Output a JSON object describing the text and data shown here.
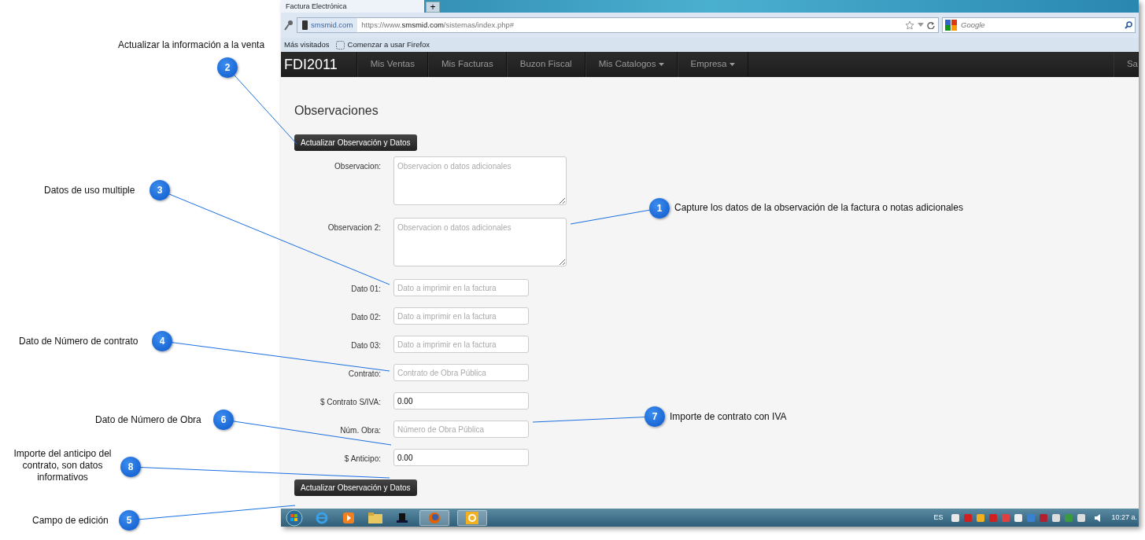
{
  "browser": {
    "tab_title": "Factura Electrónica",
    "new_tab": "+",
    "identity": "smsmid.com",
    "url": "https://www.**smsmid.com**/sistemas/index.php#",
    "search_placeholder": "Google",
    "bookmarks": [
      "Más visitados",
      "Comenzar a usar Firefox"
    ]
  },
  "navbar": {
    "brand": "FDI2011",
    "items": [
      {
        "label": "Mis Ventas",
        "dropdown": false
      },
      {
        "label": "Mis Facturas",
        "dropdown": false
      },
      {
        "label": "Buzon Fiscal",
        "dropdown": false
      },
      {
        "label": "Mis Catalogos",
        "dropdown": true
      },
      {
        "label": "Empresa",
        "dropdown": true
      }
    ],
    "right_item": "Sa"
  },
  "page": {
    "heading": "Observaciones",
    "button_top": "Actualizar Observación y Datos",
    "button_bottom": "Actualizar Observación y Datos",
    "fields": [
      {
        "kind": "textarea",
        "label": "Observacion:",
        "placeholder": "Observacion o datos adicionales"
      },
      {
        "kind": "textarea",
        "label": "Observacion 2:",
        "placeholder": "Observacion o datos adicionales"
      },
      {
        "kind": "input",
        "label": "Dato 01:",
        "placeholder": "Dato a imprimir en la factura"
      },
      {
        "kind": "input",
        "label": "Dato 02:",
        "placeholder": "Dato a imprimir en la factura"
      },
      {
        "kind": "input",
        "label": "Dato 03:",
        "placeholder": "Dato a imprimir en la factura"
      },
      {
        "kind": "input",
        "label": "Contrato:",
        "placeholder": "Contrato de Obra Pública"
      },
      {
        "kind": "input",
        "label": "$ Contrato S/IVA:",
        "value": "0.00"
      },
      {
        "kind": "input",
        "label": "Núm. Obra:",
        "placeholder": "Número de Obra Pública"
      },
      {
        "kind": "input",
        "label": "$ Anticipo:",
        "value": "0.00"
      }
    ]
  },
  "taskbar": {
    "language": "ES",
    "clock": "10:27 a."
  },
  "callouts": [
    {
      "number": "1",
      "text": "Capture los datos de la observación de la factura o notas adicionales"
    },
    {
      "number": "2",
      "text": "Actualizar la información a la venta"
    },
    {
      "number": "3",
      "text": "Datos de uso multiple"
    },
    {
      "number": "4",
      "text": "Dato de Número de contrato"
    },
    {
      "number": "5",
      "text": "Campo de edición"
    },
    {
      "number": "6",
      "text": "Dato de Número de Obra"
    },
    {
      "number": "7",
      "text": "Importe de contrato con IVA"
    },
    {
      "number": "8",
      "text": "Importe del anticipo del contrato, son datos informativos"
    }
  ]
}
